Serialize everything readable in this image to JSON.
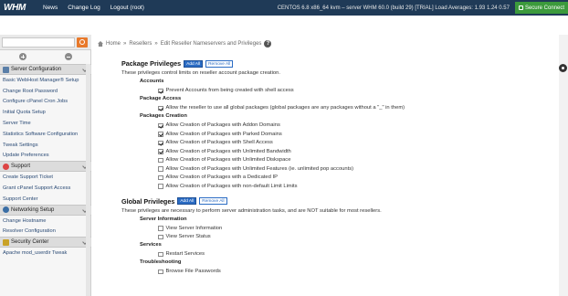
{
  "header": {
    "logo": "WHM",
    "nav": [
      "News",
      "Change Log",
      "Logout (root)"
    ],
    "server_info": "CENTOS 6.8 x86_64 kvm – server   WHM 60.0 (build 29) [TRIAL]   Load Averages: 1.93 1.24 0.57",
    "secure_label": "Secure Connect"
  },
  "sidebar": {
    "search": {
      "value": "",
      "placeholder": ""
    },
    "sections": [
      {
        "title": "Server Configuration",
        "icon_color": "#5a7fa8",
        "items": [
          "Basic WebHost Manager® Setup",
          "Change Root Password",
          "Configure cPanel Cron Jobs",
          "Initial Quota Setup",
          "Server Time",
          "Statistics Software Configuration",
          "Tweak Settings",
          "Update Preferences"
        ]
      },
      {
        "title": "Support",
        "icon_color": "#d44",
        "items": [
          "Create Support Ticket",
          "Grant cPanel Support Access",
          "Support Center"
        ]
      },
      {
        "title": "Networking Setup",
        "icon_color": "#3a6ea5",
        "items": [
          "Change Hostname",
          "Resolver Configuration"
        ]
      },
      {
        "title": "Security Center",
        "icon_color": "#c9a227",
        "items": [
          "Apache mod_userdir Tweak"
        ]
      }
    ]
  },
  "breadcrumb": {
    "home": "Home",
    "sep": "»",
    "level1": "Resellers",
    "current": "Edit Reseller Nameservers and Privileges",
    "help": "?"
  },
  "package_privileges": {
    "title": "Package Privileges",
    "add_all": "Add All",
    "remove_all": "Remove All",
    "description": "These privileges control limits on reseller account package creation.",
    "groups": [
      {
        "name": "Accounts",
        "items": [
          {
            "label": "Prevent Accounts from being created with shell access",
            "checked": true
          }
        ]
      },
      {
        "name": "Package Access",
        "items": [
          {
            "label": "Allow the reseller to use all global packages (global packages are any packages without a \"_\" in them)",
            "checked": true
          }
        ]
      },
      {
        "name": "Packages Creation",
        "items": [
          {
            "label": "Allow Creation of Packages with Addon Domains",
            "checked": true
          },
          {
            "label": "Allow Creation of Packages with Parked Domains",
            "checked": true
          },
          {
            "label": "Allow Creation of Packages with Shell Access",
            "checked": true
          },
          {
            "label": "Allow Creation of Packages with Unlimited Bandwidth",
            "checked": true
          },
          {
            "label": "Allow Creation of Packages with Unlimited Diskspace",
            "checked": false
          },
          {
            "label": "Allow Creation of Packages with Unlimited Features (ie. unlimited pop accounts)",
            "checked": false
          },
          {
            "label": "Allow Creation of Packages with a Dedicated IP",
            "checked": false
          },
          {
            "label": "Allow Creation of Packages with non-default Limit Limits",
            "checked": false
          }
        ]
      }
    ]
  },
  "global_privileges": {
    "title": "Global Privileges",
    "add_all": "Add All",
    "remove_all": "Remove All",
    "description": "These privileges are necessary to perform server administration tasks, and are NOT suitable for most resellers.",
    "groups": [
      {
        "name": "Server Information",
        "items": [
          {
            "label": "View Server Information",
            "checked": false
          },
          {
            "label": "View Server Status",
            "checked": false
          }
        ]
      },
      {
        "name": "Services",
        "items": [
          {
            "label": "Restart Services",
            "checked": false
          }
        ]
      },
      {
        "name": "Troubleshooting",
        "items": [
          {
            "label": "Browse File Passwords",
            "checked": false
          }
        ]
      }
    ]
  }
}
